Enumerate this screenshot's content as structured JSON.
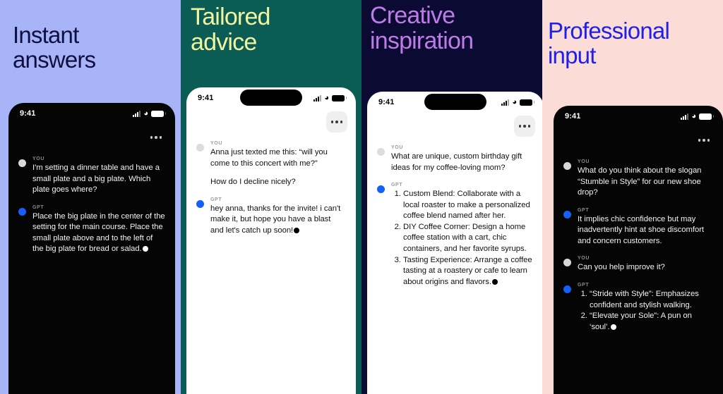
{
  "panels": [
    {
      "id": "instant-answers",
      "headline": "Instant\nanswers",
      "bg_color": "#A8B4F8",
      "headline_color": "#101040",
      "theme": "dark"
    },
    {
      "id": "tailored-advice",
      "headline": "Tailored\nadvice",
      "bg_color": "#0A5C55",
      "headline_color": "#F2F5A0",
      "theme": "light"
    },
    {
      "id": "creative-inspiration",
      "headline": "Creative\ninspiration",
      "bg_color": "#0A0A32",
      "headline_color": "#BE7BE8",
      "theme": "light"
    },
    {
      "id": "professional-input",
      "headline": "Professional\ninput",
      "bg_color": "#FBDCD7",
      "headline_color": "#1F20E8",
      "theme": "dark"
    }
  ],
  "status_bar": {
    "time": "9:41",
    "signal_icon": "cellular-bars-icon",
    "wifi_icon": "wifi-icon",
    "battery_icon": "battery-icon"
  },
  "more_button_label": "more-options",
  "roles": {
    "user": "YOU",
    "assistant": "GPT"
  },
  "phone1": {
    "messages": [
      {
        "role": "YOU",
        "sender": "user",
        "paragraphs": [
          "I'm setting a dinner table and have a small plate and a big plate. Which plate goes where?"
        ],
        "cursor": false
      },
      {
        "role": "GPT",
        "sender": "assistant",
        "paragraphs": [
          "Place the big plate in the center of the setting for the main course. Place the small plate above and to the left of the big plate for bread or salad."
        ],
        "cursor": true
      }
    ]
  },
  "phone2": {
    "messages": [
      {
        "role": "YOU",
        "sender": "user",
        "paragraphs": [
          "Anna just texted me this: “will you come to this concert with me?”",
          "How do I decline nicely?"
        ],
        "cursor": false
      },
      {
        "role": "GPT",
        "sender": "assistant",
        "paragraphs": [
          "hey anna, thanks for the invite! i can't make it, but hope you have a blast and let's catch up soon!"
        ],
        "cursor": true
      }
    ]
  },
  "phone3": {
    "messages": [
      {
        "role": "YOU",
        "sender": "user",
        "paragraphs": [
          "What are unique, custom birthday gift ideas for my coffee-loving mom?"
        ],
        "cursor": false
      },
      {
        "role": "GPT",
        "sender": "assistant",
        "list": [
          "Custom Blend: Collaborate with a local roaster to make a personalized coffee blend named after her.",
          "DIY Coffee Corner: Design a home coffee station with a cart, chic containers, and her favorite syrups.",
          "Tasting Experience: Arrange a coffee tasting at a roastery or cafe to learn about origins and flavors."
        ],
        "cursor": true
      }
    ]
  },
  "phone4": {
    "messages": [
      {
        "role": "YOU",
        "sender": "user",
        "paragraphs": [
          "What do you think about the slogan “Stumble in Style” for our new shoe drop?"
        ],
        "cursor": false
      },
      {
        "role": "GPT",
        "sender": "assistant",
        "paragraphs": [
          "It implies chic confidence but may inadvertently hint at shoe discomfort and concern customers."
        ],
        "cursor": false
      },
      {
        "role": "YOU",
        "sender": "user",
        "paragraphs": [
          "Can you help improve it?"
        ],
        "cursor": false
      },
      {
        "role": "GPT",
        "sender": "assistant",
        "list": [
          "“Stride with Style”: Emphasizes confident and stylish walking.",
          "“Elevate your Sole”: A pun on ‘soul’."
        ],
        "cursor": true
      }
    ]
  }
}
